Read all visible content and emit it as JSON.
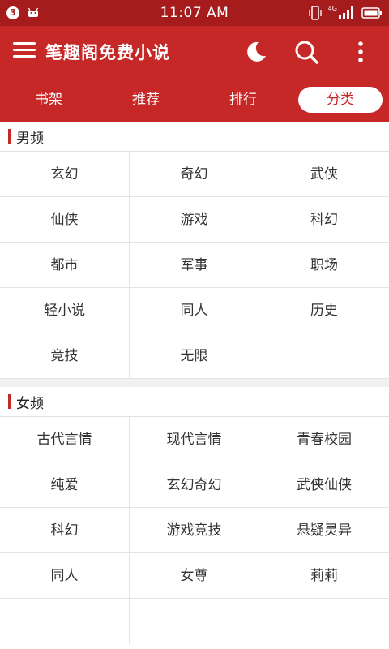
{
  "status": {
    "notification_count": "3",
    "time": "11:07 AM",
    "network": "4G"
  },
  "app": {
    "title": "笔趣阁免费小说",
    "accent": "#c62828"
  },
  "tabs": [
    {
      "label": "书架"
    },
    {
      "label": "推荐"
    },
    {
      "label": "排行"
    },
    {
      "label": "分类",
      "active": true
    }
  ],
  "male": {
    "title": "男频",
    "items": [
      "玄幻",
      "奇幻",
      "武侠",
      "仙侠",
      "游戏",
      "科幻",
      "都市",
      "军事",
      "职场",
      "轻小说",
      "同人",
      "历史",
      "竞技",
      "无限"
    ]
  },
  "female": {
    "title": "女频",
    "items": [
      "古代言情",
      "现代言情",
      "青春校园",
      "纯爱",
      "玄幻奇幻",
      "武侠仙侠",
      "科幻",
      "游戏竞技",
      "悬疑灵异",
      "同人",
      "女尊",
      "莉莉"
    ]
  }
}
